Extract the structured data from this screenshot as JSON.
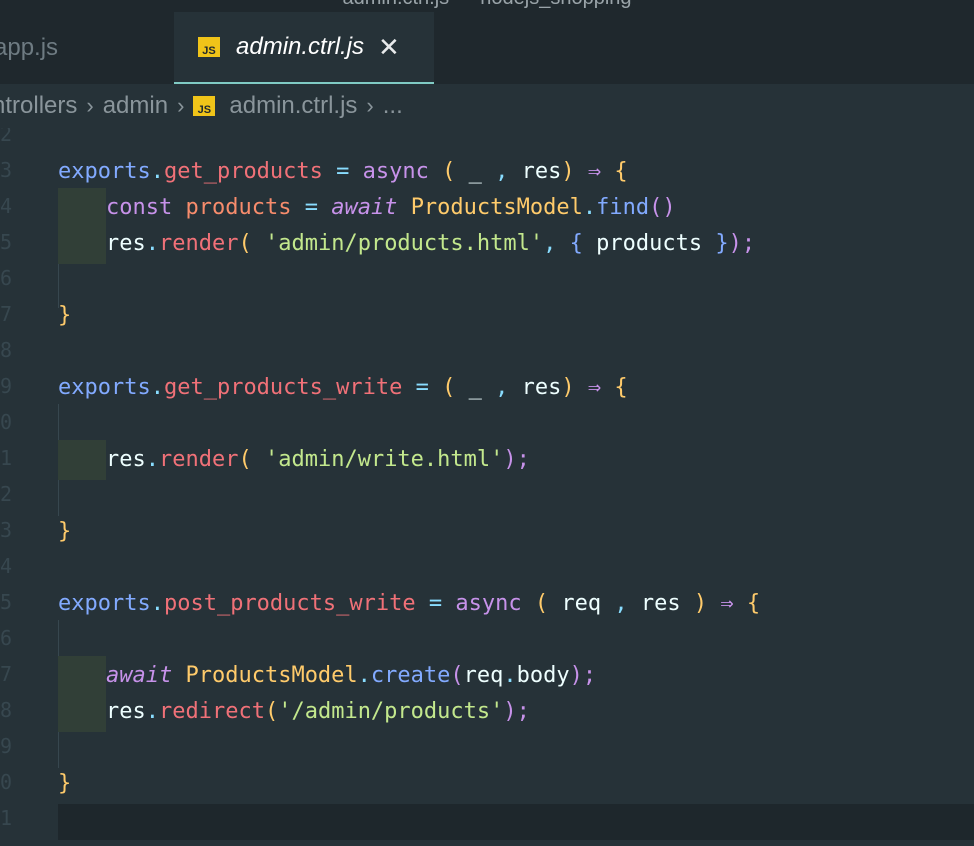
{
  "window": {
    "title": "admin.ctrl.js — nodejs_shopping"
  },
  "tabs": [
    {
      "label": "app.js",
      "active": false,
      "icon": "js-file-icon"
    },
    {
      "label": "admin.ctrl.js",
      "active": true,
      "icon": "js-file-icon",
      "close": "✕"
    }
  ],
  "file_badge": "JS",
  "breadcrumb": {
    "folder1": "ntrollers",
    "folder2": "admin",
    "file": "admin.ctrl.js",
    "more": "...",
    "separator": "›"
  },
  "line_numbers": [
    "2",
    "3",
    "4",
    "5",
    "6",
    "7",
    "8",
    "9",
    "0",
    "1",
    "2",
    "3",
    "4",
    "5",
    "6",
    "7",
    "8",
    "9",
    "0",
    "1"
  ],
  "code": {
    "l3": [
      "exports",
      ".",
      "get_products",
      " = ",
      "async",
      " ( ",
      "_",
      " , ",
      "res",
      ")",
      " ⇒ ",
      "{"
    ],
    "l4": [
      "const",
      " ",
      "products",
      " = ",
      "await",
      " ",
      "ProductsModel",
      ".",
      "find",
      "()"
    ],
    "l5": [
      "res",
      ".",
      "render",
      "(",
      " ",
      "'admin/products.html'",
      ", ",
      "{",
      " products ",
      "}",
      ");"
    ],
    "l7": [
      "}"
    ],
    "l9": [
      "exports",
      ".",
      "get_products_write",
      " = ",
      "(",
      " _ ",
      ",",
      " res",
      ")",
      " ⇒ ",
      "{"
    ],
    "l11": [
      "res",
      ".",
      "render",
      "(",
      " ",
      "'admin/write.html'",
      ");"
    ],
    "l13": [
      "}"
    ],
    "l15": [
      "exports",
      ".",
      "post_products_write",
      " = ",
      "async",
      " ( ",
      "req",
      " , ",
      "res",
      " )",
      " ⇒ ",
      "{"
    ],
    "l17": [
      "await",
      " ",
      "ProductsModel",
      ".",
      "create",
      "(",
      "req",
      ".",
      "body",
      ");"
    ],
    "l18": [
      "res",
      ".",
      "redirect",
      "(",
      "'/admin/products'",
      ");"
    ],
    "l20": [
      "}"
    ]
  },
  "colors": {
    "background": "#263238",
    "tab_accent": "#80cbc4",
    "js_badge": "#f0c419"
  }
}
